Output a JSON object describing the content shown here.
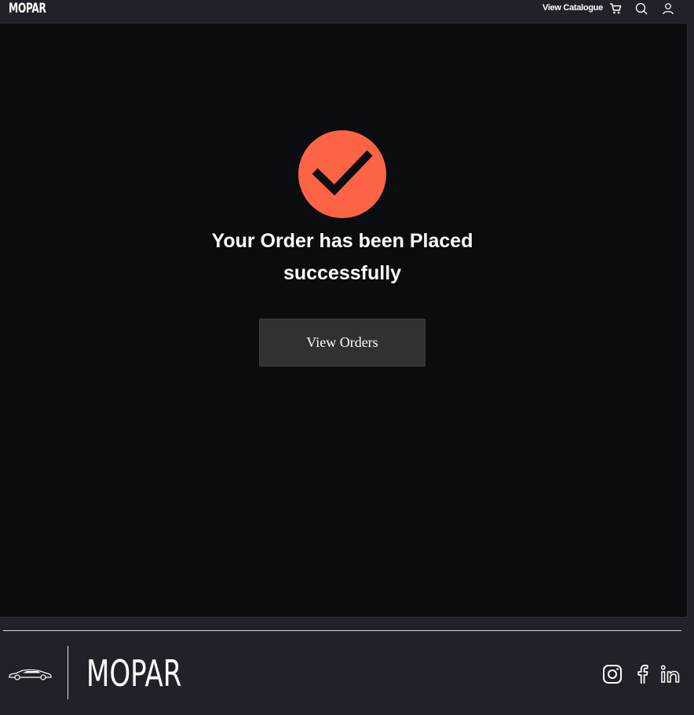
{
  "header": {
    "brand": "MOPAR",
    "view_catalogue_label": "View Catalogue",
    "icons": [
      "cart-icon",
      "search-icon",
      "user-icon"
    ]
  },
  "confirmation": {
    "icon": "check-icon",
    "icon_color": "#fd6446",
    "title_line1": "Your Order has been Placed",
    "title_line2": "successfully",
    "view_orders_label": "View Orders"
  },
  "footer": {
    "brand": "MOPAR",
    "car_icon": "car-icon",
    "social_icons": [
      "instagram-icon",
      "facebook-icon",
      "linkedin-icon"
    ]
  },
  "colors": {
    "page_background": "#1f2228",
    "panel_background": "#0a0c10",
    "accent": "#fd6446",
    "button_background": "#303134"
  }
}
